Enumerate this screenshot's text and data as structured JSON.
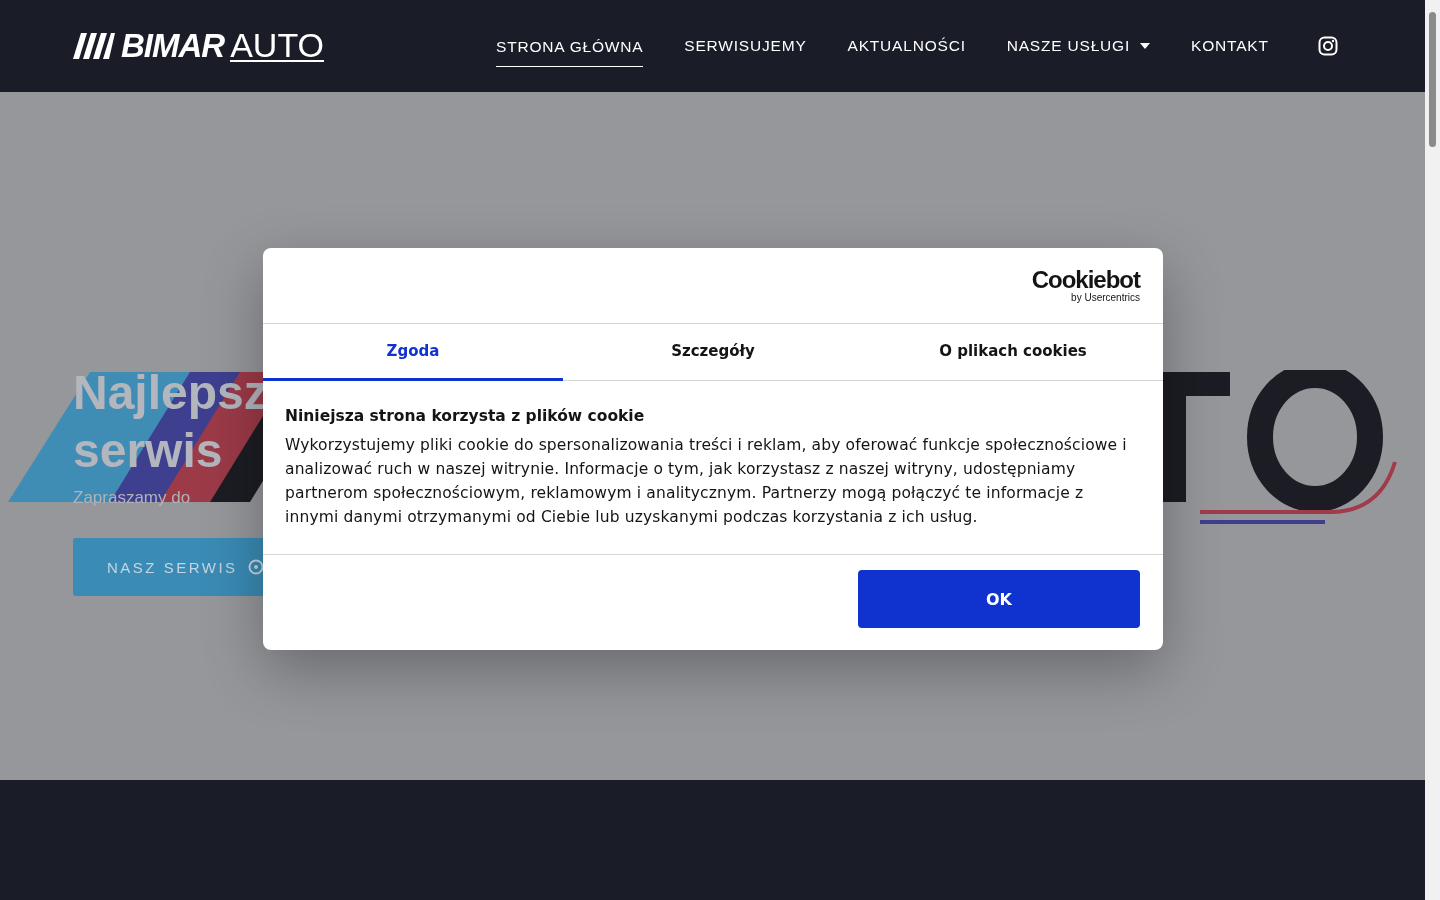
{
  "header": {
    "logo": {
      "brand": "BIMAR",
      "suffix": "AUTO"
    },
    "nav": [
      {
        "label": "STRONA GŁÓWNA",
        "selected": true,
        "dropdown": false
      },
      {
        "label": "SERWISUJEMY",
        "selected": false,
        "dropdown": false
      },
      {
        "label": "AKTUALNOŚCI",
        "selected": false,
        "dropdown": false
      },
      {
        "label": "NASZE USŁUGI",
        "selected": false,
        "dropdown": true
      },
      {
        "label": "KONTAKT",
        "selected": false,
        "dropdown": false
      }
    ]
  },
  "hero": {
    "title_lines": [
      "Najlepsz",
      "serwis"
    ],
    "subtitle": "Zapraszamy do",
    "button": "NASZ SERWIS",
    "background": {
      "kind": "picture"
    }
  },
  "cookie_dialog": {
    "logo": "Cookiebot",
    "logo_byline": "by Usercentrics",
    "tabs": [
      {
        "label": "Zgoda",
        "selected": true
      },
      {
        "label": "Szczegóły",
        "selected": false
      },
      {
        "label": "O plikach cookies",
        "selected": false
      }
    ],
    "heading": "Niniejsza strona korzysta z plików cookie",
    "body": "Wykorzystujemy pliki cookie do spersonalizowania treści i reklam, aby oferować funkcje społecznościowe i analizować ruch w naszej witrynie. Informacje o tym, jak korzystasz z naszej witryny, udostępniamy partnerom społecznościowym, reklamowym i analitycznym. Partnerzy mogą połączyć te informacje z innymi danymi otrzymanymi od Ciebie lub uzyskanymi podczas korzystania z ich usług.",
    "button": "OK"
  }
}
